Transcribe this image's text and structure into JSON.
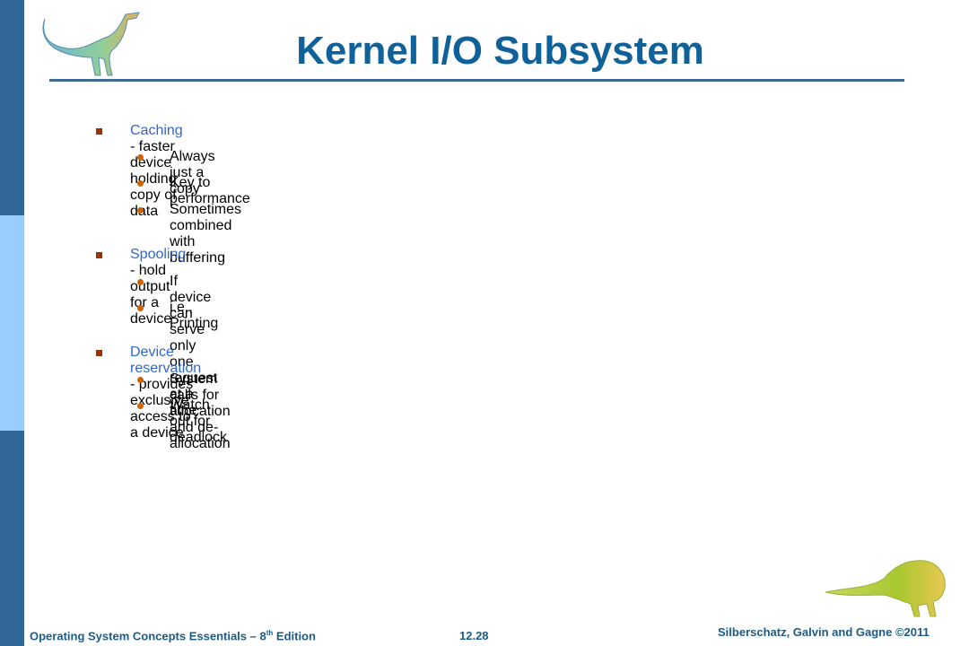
{
  "slide": {
    "title": "Kernel I/O Subsystem",
    "bullets": [
      {
        "keyword": "Caching",
        "text": " - faster device holding copy of data",
        "sub": [
          "Always just a copy",
          "Key to performance",
          "Sometimes combined with buffering"
        ]
      },
      {
        "keyword": "Spooling",
        "text": " - hold output for a device",
        "sub": [
          "If device can serve only one request at a time",
          "i.e., Printing"
        ]
      },
      {
        "keyword": "Device reservation",
        "text": " - provides exclusive access to a device",
        "sub": [
          "System calls for allocation and de-allocation",
          "Watch out for deadlock"
        ]
      }
    ]
  },
  "footer": {
    "book_prefix": "Operating System Concepts Essentials – 8",
    "book_sup": "th",
    "book_suffix": " Edition",
    "page": "12.28",
    "copyright": "Silberschatz, Galvin and Gagne ©2011"
  },
  "colors": {
    "sidebar_dark": "#336699",
    "sidebar_light": "#99ccff",
    "title": "#0f6199",
    "keyword": "#3366cc",
    "bullet_l1": "#993300",
    "bullet_l2": "#cc6600"
  }
}
